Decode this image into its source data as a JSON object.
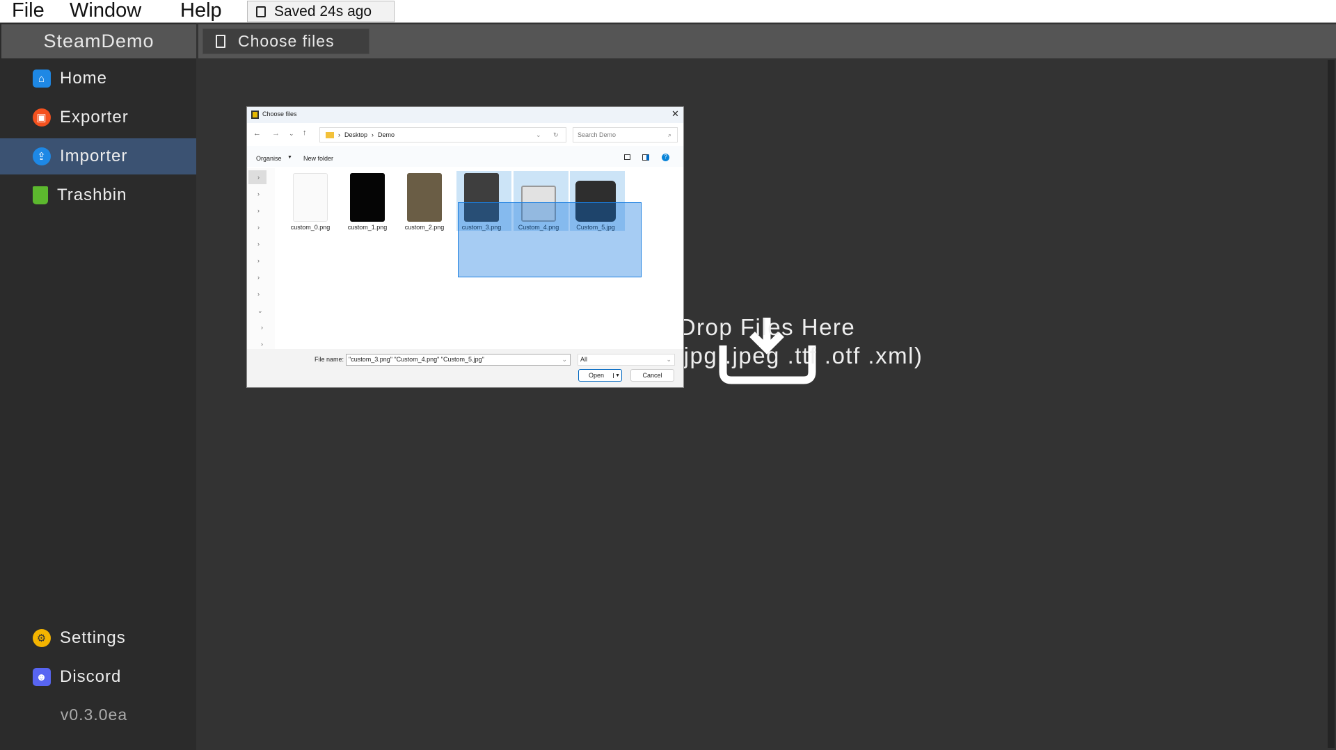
{
  "menubar": {
    "items": [
      "File",
      "Window",
      "Help"
    ],
    "saved": "Saved 24s ago"
  },
  "app": {
    "title": "SteamDemo",
    "choose_files": "Choose files",
    "version": "v0.3.0ea"
  },
  "sidebar": {
    "items": [
      {
        "label": "Home",
        "icon": "home-icon"
      },
      {
        "label": "Exporter",
        "icon": "image-icon"
      },
      {
        "label": "Importer",
        "icon": "upload-icon",
        "selected": true
      },
      {
        "label": "Trashbin",
        "icon": "trash-icon"
      }
    ],
    "bottom": [
      {
        "label": "Settings",
        "icon": "gear-icon"
      },
      {
        "label": "Discord",
        "icon": "discord-icon"
      }
    ]
  },
  "drop": {
    "title": "Drop Files Here",
    "extensions": "(.png .jpg .jpeg .ttf .otf .xml)"
  },
  "dialog": {
    "title": "Choose files",
    "breadcrumb": [
      "Desktop",
      "Demo"
    ],
    "search_placeholder": "Search Demo",
    "organise": "Organise",
    "new_folder": "New folder",
    "files": [
      {
        "name": "custom_0.png",
        "selected": false,
        "color": "#fafafa"
      },
      {
        "name": "custom_1.png",
        "selected": false,
        "color": "#0a0a0a"
      },
      {
        "name": "custom_2.png",
        "selected": false,
        "color": "#6a5d45"
      },
      {
        "name": "custom_3.png",
        "selected": true,
        "color": "#3e3e3e"
      },
      {
        "name": "Custom_4.png",
        "selected": true,
        "color": "#e0e0e0"
      },
      {
        "name": "Custom_5.jpg",
        "selected": true,
        "color": "#2e2e2e"
      }
    ],
    "file_name_label": "File name:",
    "file_name_value": "\"custom_3.png\" \"Custom_4.png\" \"Custom_5.jpg\"",
    "filter": "All",
    "open": "Open",
    "cancel": "Cancel"
  },
  "colors": {
    "selected_nav": "#3b5272",
    "selection": "#cce4f7",
    "accent": "#0067c0"
  }
}
